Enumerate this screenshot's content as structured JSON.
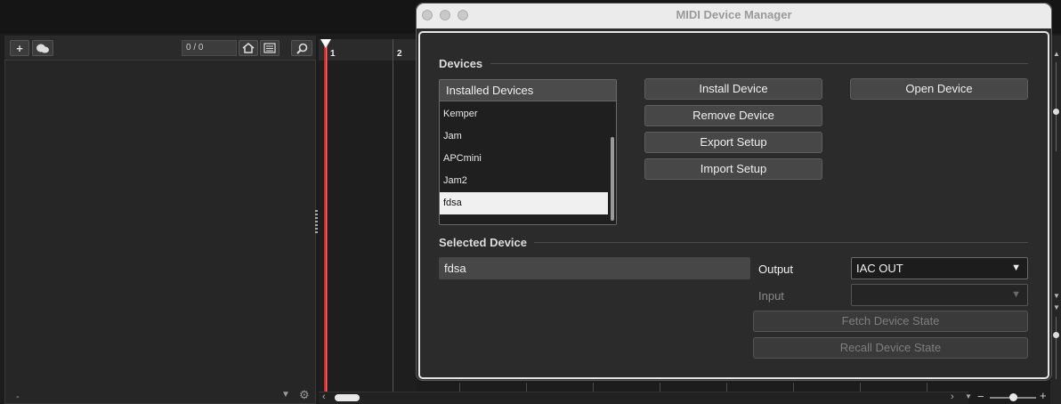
{
  "daw": {
    "counter": "0 / 0",
    "ruler_markers": [
      "1",
      "2"
    ],
    "bottom_left_text": "-"
  },
  "dialog": {
    "title": "MIDI Device Manager",
    "devices_section": {
      "title": "Devices",
      "list_header": "Installed Devices",
      "items": [
        "Kemper",
        "Jam",
        "APCmini",
        "Jam2",
        "fdsa"
      ],
      "selected_item": "fdsa"
    },
    "buttons": {
      "install": "Install Device",
      "open": "Open Device",
      "remove": "Remove Device",
      "export": "Export Setup",
      "import": "Import Setup"
    },
    "selected_section": {
      "title": "Selected Device",
      "name": "fdsa",
      "output_label": "Output",
      "output_value": "IAC OUT",
      "input_label": "Input",
      "input_value": "",
      "fetch_label": "Fetch Device State",
      "recall_label": "Recall Device State"
    }
  },
  "icons": [
    "plus-icon",
    "cloud-icon",
    "home-icon",
    "list-icon",
    "search-icon",
    "gear-icon",
    "dropdown-arrow-icon",
    "zoom-minus-icon",
    "zoom-plus-icon"
  ],
  "colors": {
    "playhead": "#c42b2b",
    "selection": "#f0f0f0",
    "dialog_bg": "#2b2b2b"
  }
}
